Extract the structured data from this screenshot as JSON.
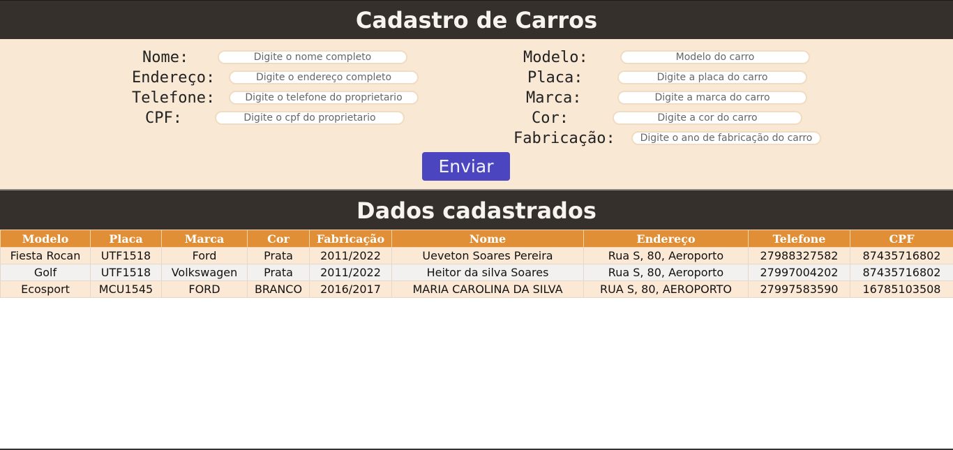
{
  "header": {
    "title": "Cadastro de Carros"
  },
  "form": {
    "owner": {
      "name_label": "Nome:",
      "name_placeholder": "Digite o nome completo",
      "address_label": "Endereço:",
      "address_placeholder": "Digite o endereço completo",
      "phone_label": "Telefone:",
      "phone_placeholder": "Digite o telefone do proprietario",
      "cpf_label": "CPF:",
      "cpf_placeholder": "Digite o cpf do proprietario"
    },
    "car": {
      "model_label": "Modelo:",
      "model_placeholder": "Modelo do carro",
      "plate_label": "Placa:",
      "plate_placeholder": "Digite a placa do carro",
      "brand_label": "Marca:",
      "brand_placeholder": "Digite a marca do carro",
      "color_label": "Cor:",
      "color_placeholder": "Digite a cor do carro",
      "year_label": "Fabricação:",
      "year_placeholder": "Digite o ano de fabricação do carro"
    },
    "submit_label": "Enviar"
  },
  "data_section": {
    "title": "Dados cadastrados"
  },
  "table": {
    "headers": [
      "Modelo",
      "Placa",
      "Marca",
      "Cor",
      "Fabricação",
      "Nome",
      "Endereço",
      "Telefone",
      "CPF"
    ],
    "rows": [
      [
        "Fiesta Rocan",
        "UTF1518",
        "Ford",
        "Prata",
        "2011/2022",
        "Ueveton Soares Pereira",
        "Rua S, 80, Aeroporto",
        "27988327582",
        "87435716802"
      ],
      [
        "Golf",
        "UTF1518",
        "Volkswagen",
        "Prata",
        "2011/2022",
        "Heitor da silva Soares",
        "Rua S, 80, Aeroporto",
        "27997004202",
        "87435716802"
      ],
      [
        "Ecosport",
        "MCU1545",
        "FORD",
        "BRANCO",
        "2016/2017",
        "MARIA CAROLINA DA SILVA",
        "RUA S, 80, AEROPORTO",
        "27997583590",
        "16785103508"
      ]
    ]
  },
  "colors": {
    "header_bg": "#35302c",
    "form_bg": "#f8e8d4",
    "button_bg": "#4b46bf",
    "table_header_bg": "#e08f37"
  }
}
